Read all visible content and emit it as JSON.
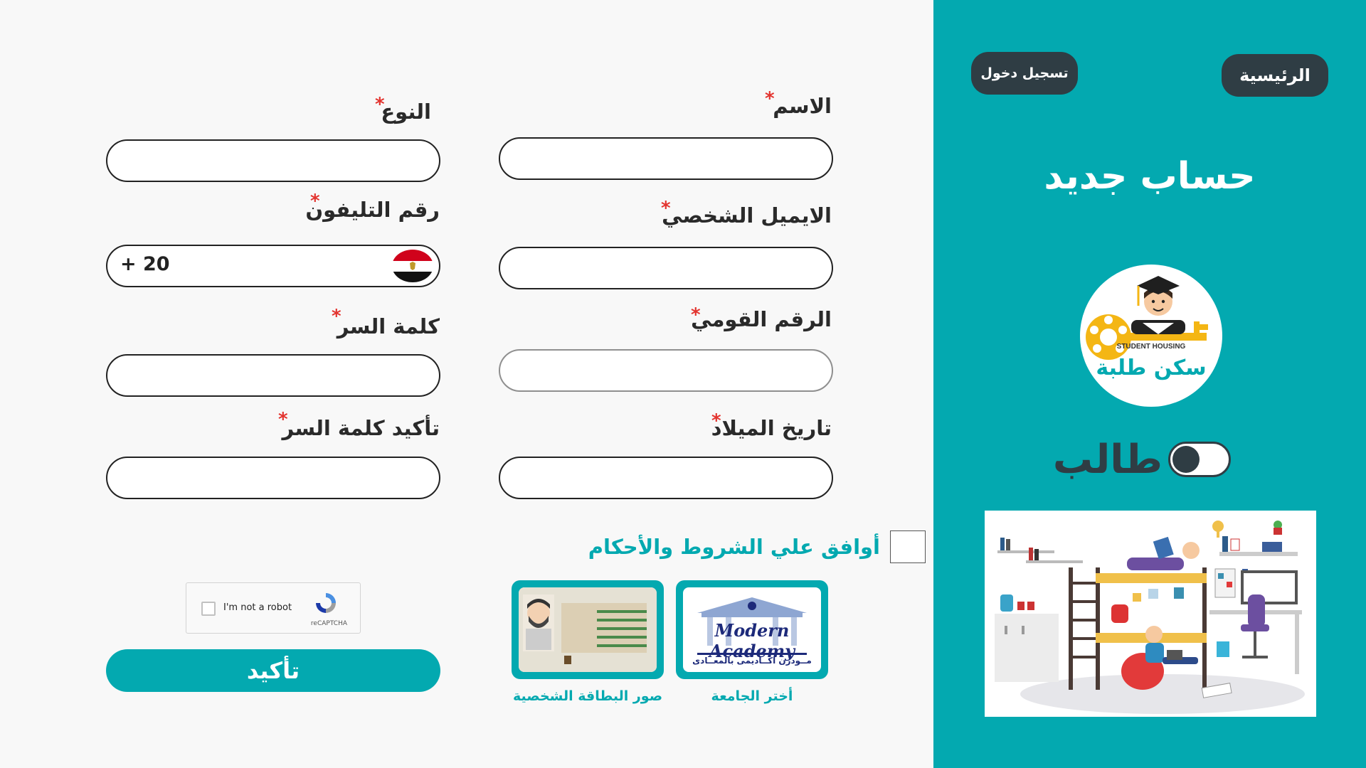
{
  "nav": {
    "home_label": "الرئيسية",
    "login_label": "تسجيل دخول"
  },
  "side": {
    "title": "حساب جديد",
    "logo_text_en": "STUDENT HOUSING",
    "logo_text_ar": "سكن طلبة",
    "role_label": "طالب",
    "role_toggle_on": false
  },
  "form": {
    "name_label": "الاسم",
    "gender_label": "النوع",
    "email_label": "الايميل  الشخصي",
    "phone_label": "رقم التليفون",
    "phone_code": "+ 20",
    "national_id_label": "الرقم القومي",
    "password_label": "كلمة السر",
    "birthdate_label": "تاريخ الميلاد",
    "confirm_password_label": "تأكيد كلمة السر",
    "required_mark": "*",
    "terms_label": "أوافق علي الشروط والأحكام",
    "submit_label": "تأكيد"
  },
  "captcha": {
    "text": "I'm not a robot",
    "brand": "reCAPTCHA"
  },
  "cards": {
    "id_card_caption": "صور البطاقة الشخصية",
    "university_caption": "أختر الجامعة",
    "university_name": "Modern Academy",
    "university_name_ar": "مــودرن اكــاديمى بالمعــادى"
  },
  "colors": {
    "accent": "#03a9b0",
    "dark": "#2f3d44",
    "required": "#e3342f"
  }
}
